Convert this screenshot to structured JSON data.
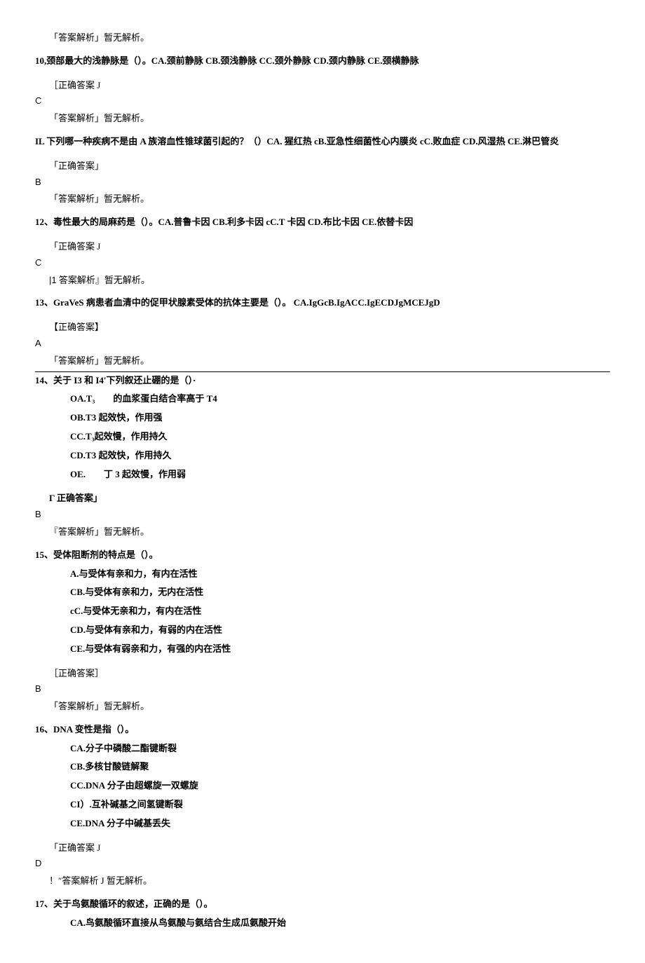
{
  "q9_analysis": "「答案解析」暂无解析。",
  "q10": {
    "num": "10,",
    "stem": "颈部最大的浅静脉是（）。CA.颈前静脉 CB.颈浅静脉 CC.颈外静脉 CD.颈内静脉 CE.颈横静脉",
    "ans_label": "［正确答案 J",
    "ans": "C",
    "analysis": "「答案解析」暂无解析。"
  },
  "q11": {
    "num": "IL",
    "stem": " 下列哪一种疾病不是由 A 族溶血性锥球菌引起的？（）CA. 猩红热 cB.亚急性细菌性心内膜炎 cC.败血症 CD.风湿热 CE.淋巴管炎",
    "ans_label": "「正确答案」",
    "ans": "B",
    "analysis": "「答案解析」暂无解析。"
  },
  "q12": {
    "num": "12、",
    "stem": "毒性最大的局麻药是（）。CA.普鲁卡因 CB.利多卡因 cC.T 卡因 CD.布比卡因 CE.依替卡因",
    "ans_label": "「正确答案 J",
    "ans": "C",
    "analysis_prefix": "|1",
    "analysis": " 答案解析』暂无解析。"
  },
  "q13": {
    "num": "13、",
    "stem": "GraVeS 病患者血清中的促甲状腺素受体的抗体主要是（）。 CA.IgGcB.IgACC.IgECDJgMCEJgD",
    "ans_label": "【正确答案】",
    "ans": "A",
    "analysis": "「答案解析」暂无解析。"
  },
  "q14": {
    "num": "14、",
    "stem": "关于 I3 和 I4'下列叙还止硼的是（）·",
    "opts": [
      "OA.T₃　　的血浆蛋白结合率高于 T4",
      "OB.T3 起效快，作用强",
      "CC.T₃起效慢，作用持久",
      "CD.T3 起效快，作用持久",
      "OE.　　丁 3 起效慢，作用弱"
    ],
    "ans_label": "Γ 正确答案」",
    "ans": "B",
    "analysis": "『答案解析」暂无解析。"
  },
  "q15": {
    "num": "15、",
    "stem": "受体阻断剂的特点是（）。",
    "opts": [
      "A.与受体有亲和力，有内在活性",
      "CB.与受体有亲和力，无内在活性",
      "cC.与受体无亲和力，有内在活性",
      "CD.与受体有亲和力，有弱的内在活性",
      "CE.与受体有弱亲和力，有强的内在活性"
    ],
    "ans_label": "［正确答案］",
    "ans": "B",
    "analysis": "「答案解析」暂无解析。"
  },
  "q16": {
    "num": "16、",
    "stem": "DNA 变性是指（）。",
    "opts": [
      "CA.分子中磷酸二酯键断裂",
      "CB.多核甘酸链解聚",
      "CC.DNA 分子由超螺旋一双螺旋",
      "CI）.互补碱基之间氢键断裂",
      "CE.DNA 分子中碱基丢失"
    ],
    "ans_label": "「正确答案 J",
    "ans": "D",
    "analysis": "！″答案解析 J 暂无解析。"
  },
  "q17": {
    "num": "17、",
    "stem": "关于鸟氨酸循环的叙述，正确的是（）。",
    "opts": [
      "CA.鸟氨酸循环直接从鸟氨酸与氨结合生成瓜氨酸开始"
    ]
  }
}
